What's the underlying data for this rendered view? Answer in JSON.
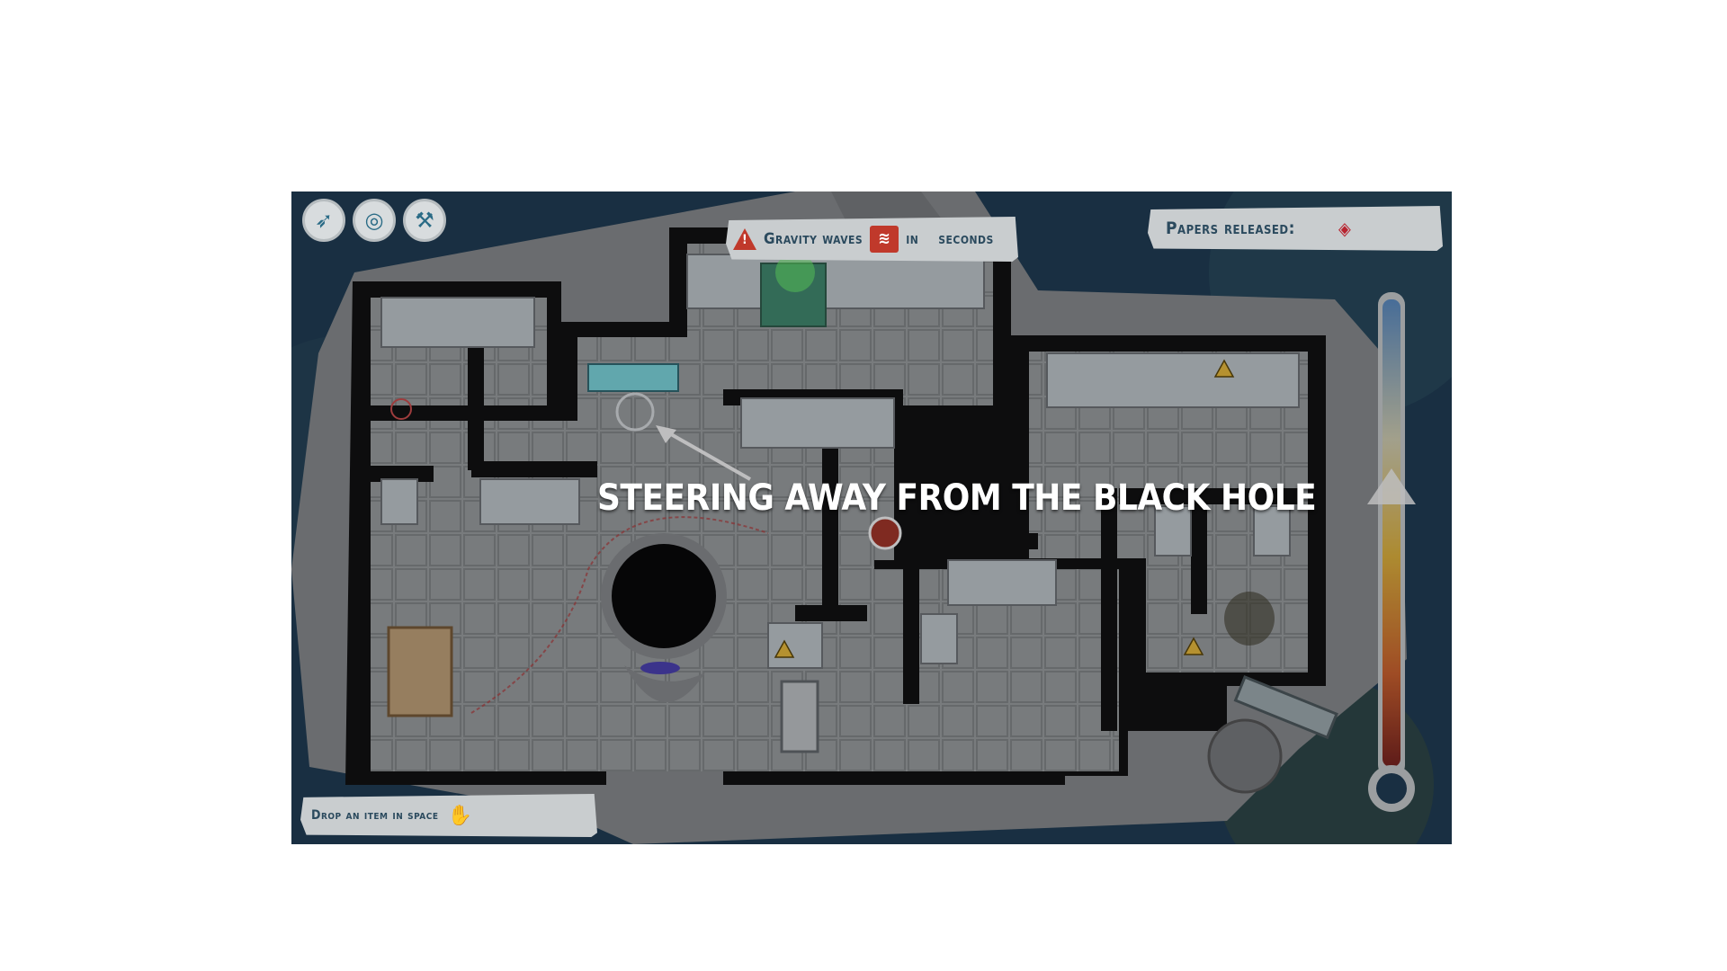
{
  "toolbar": {
    "buttons": [
      {
        "name": "wing-icon",
        "glyph": "➶"
      },
      {
        "name": "target-icon",
        "glyph": "◎"
      },
      {
        "name": "hammer-icon",
        "glyph": "⚒"
      }
    ]
  },
  "gravity_banner": {
    "label": "Gravity waves",
    "in": "in",
    "seconds": "seconds",
    "warning_icon": "warning-triangle-icon",
    "wave_icon": "gravity-waves-icon"
  },
  "papers_banner": {
    "label": "Papers released:",
    "marker_icon": "diamond-marker-icon"
  },
  "drop_banner": {
    "label": "Drop an item in space",
    "icon": "hand-drop-icon"
  },
  "callout": {
    "text": "STEERING AWAY FROM THE BLACK HOLE"
  },
  "thermometer": {
    "level": 0.6
  },
  "colors": {
    "banner_bg": "#c9cdcf",
    "banner_text": "#2b4a5e",
    "warning": "#c0392b",
    "space": "#1b3a52",
    "hull": "#8a8a8a",
    "floor": "#9b9ea0",
    "wall": "#0b0b0b"
  }
}
